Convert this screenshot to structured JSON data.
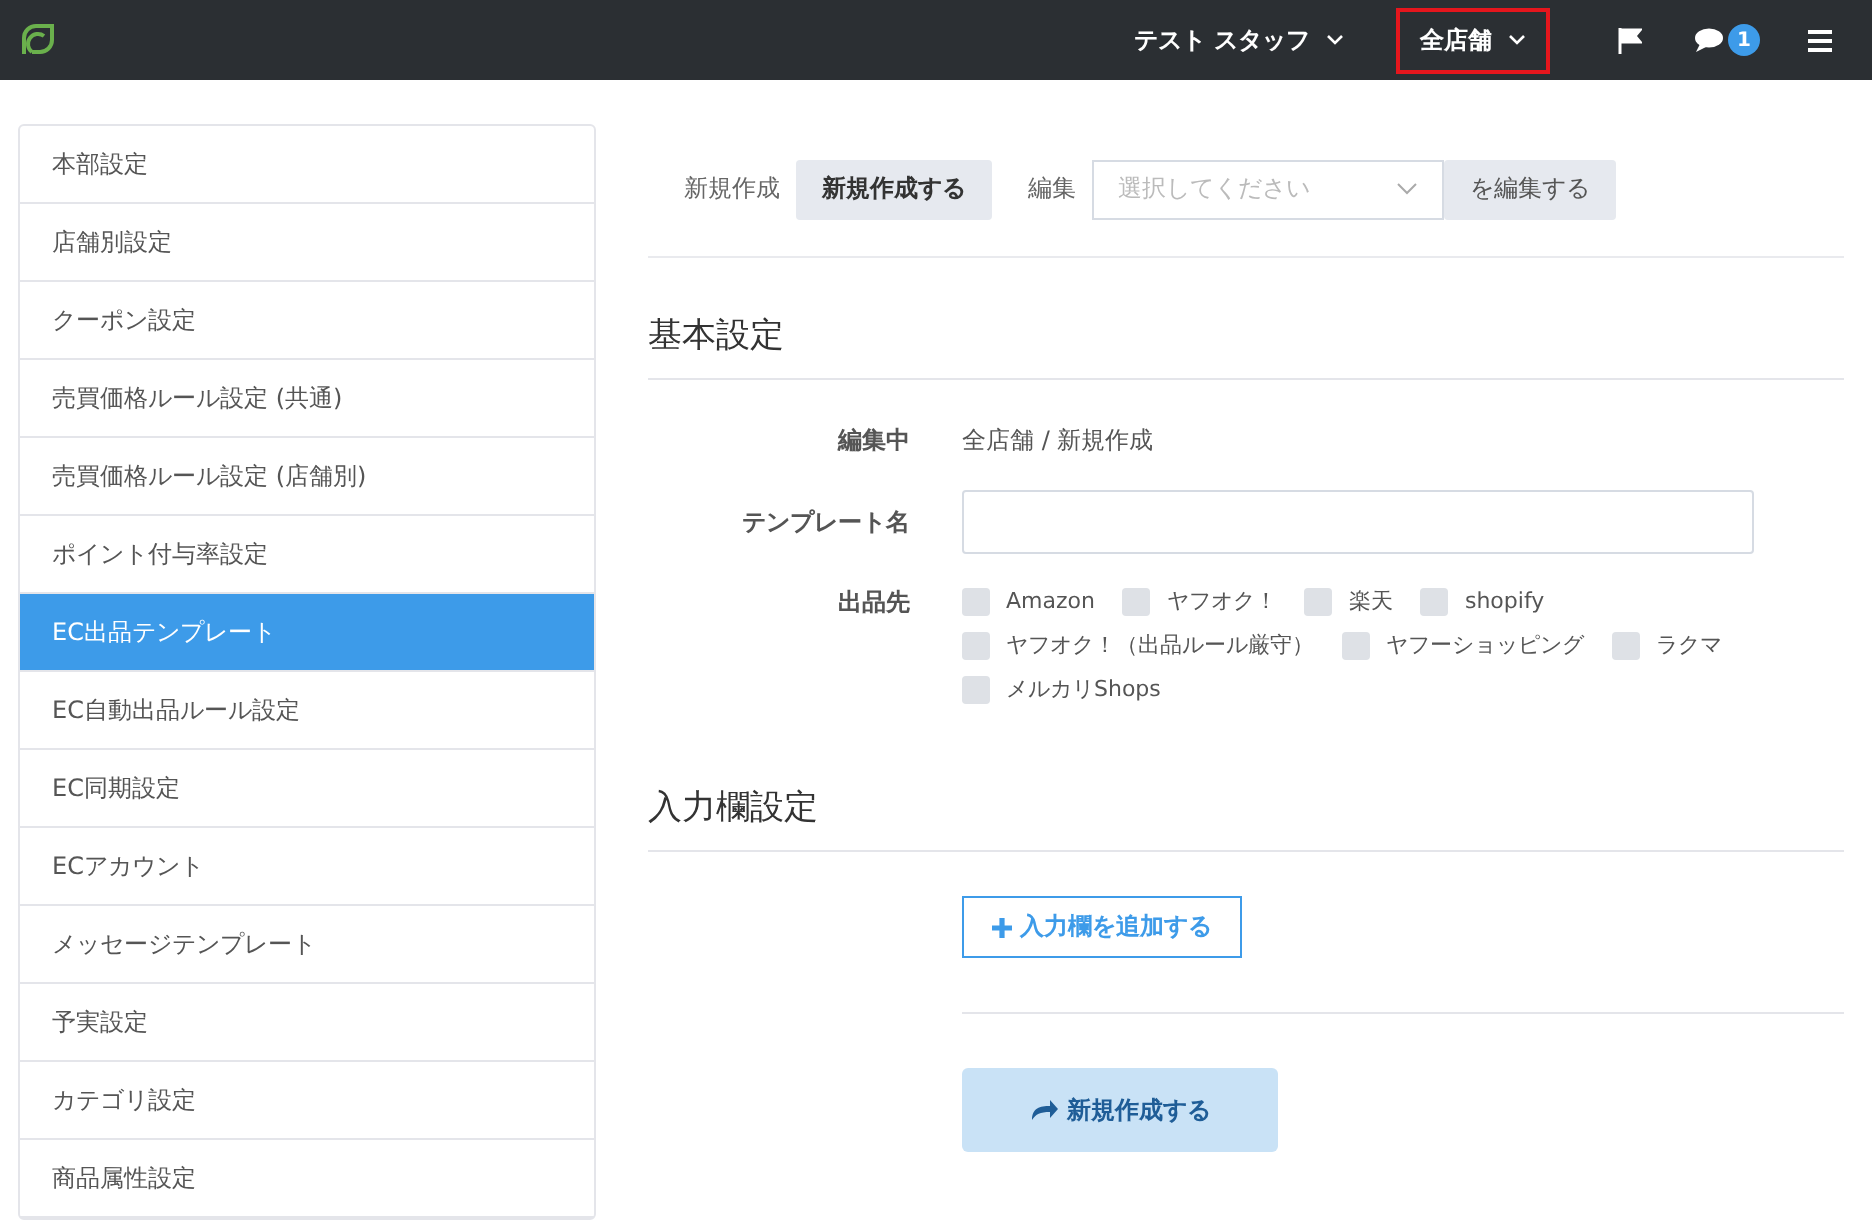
{
  "topbar": {
    "menus": [
      {
        "label": "テスト スタッフ",
        "highlighted": false
      },
      {
        "label": "全店舗",
        "highlighted": true
      }
    ],
    "message_count": "1"
  },
  "sidebar": {
    "items": [
      {
        "label": "本部設定",
        "selected": false
      },
      {
        "label": "店舗別設定",
        "selected": false
      },
      {
        "label": "クーポン設定",
        "selected": false
      },
      {
        "label": "売買価格ルール設定 (共通)",
        "selected": false
      },
      {
        "label": "売買価格ルール設定 (店舗別)",
        "selected": false
      },
      {
        "label": "ポイント付与率設定",
        "selected": false
      },
      {
        "label": "EC出品テンプレート",
        "selected": true
      },
      {
        "label": "EC自動出品ルール設定",
        "selected": false
      },
      {
        "label": "EC同期設定",
        "selected": false
      },
      {
        "label": "ECアカウント",
        "selected": false
      },
      {
        "label": "メッセージテンプレート",
        "selected": false
      },
      {
        "label": "予実設定",
        "selected": false
      },
      {
        "label": "カテゴリ設定",
        "selected": false
      },
      {
        "label": "商品属性設定",
        "selected": false
      }
    ]
  },
  "toolbar": {
    "new_label": "新規作成",
    "new_button": "新規作成する",
    "edit_label": "編集",
    "edit_select": {
      "placeholder": "選択してください"
    },
    "edit_button": "を編集する"
  },
  "basic": {
    "heading": "基本設定",
    "editing_label": "編集中",
    "editing_value": "全店舗 / 新規作成",
    "name_label": "テンプレート名",
    "targets_label": "出品先",
    "targets": [
      {
        "label": "Amazon",
        "checked": false
      },
      {
        "label": "ヤフオク！",
        "checked": false
      },
      {
        "label": "楽天",
        "checked": false
      },
      {
        "label": "shopify",
        "checked": false
      },
      {
        "label": "ヤフオク！（出品ルール厳守）",
        "checked": false
      },
      {
        "label": "ヤフーショッピング",
        "checked": false
      },
      {
        "label": "ラクマ",
        "checked": false
      },
      {
        "label": "メルカリShops",
        "checked": false
      }
    ]
  },
  "inputs": {
    "heading": "入力欄設定",
    "add_button": "入力欄を追加する"
  },
  "submit_button": "新規作成する"
}
